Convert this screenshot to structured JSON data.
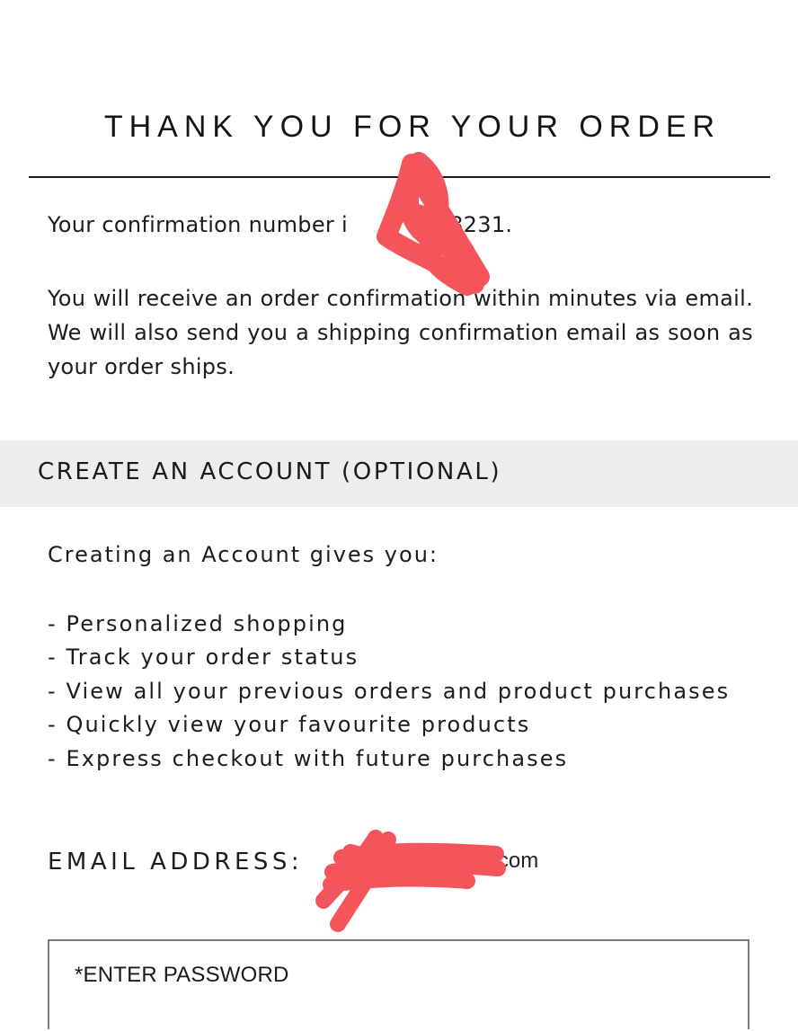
{
  "order": {
    "title": "THANK YOU FOR YOUR ORDER",
    "confirmation_prefix": "Your confirmation number i",
    "confirmation_visible_suffix": "108231.",
    "notice": "You will receive an order confirmation within minutes via email. We will also send you a shipping confirmation email as soon as your order ships."
  },
  "account": {
    "section_title": "CREATE AN ACCOUNT (OPTIONAL)",
    "intro": "Creating an Account gives you:",
    "benefits": [
      "- Personalized shopping",
      "- Track your order status",
      "- View all your previous orders and product purchases",
      "- Quickly view your favourite products",
      "- Express checkout with future purchases"
    ],
    "email_label": "EMAIL ADDRESS:",
    "email_visible_suffix": "hoo.com",
    "password_placeholder": "*ENTER PASSWORD"
  },
  "colors": {
    "section_band": "#eceeed",
    "redaction_scribble": "#f4555a",
    "text": "#1c1c1c"
  }
}
